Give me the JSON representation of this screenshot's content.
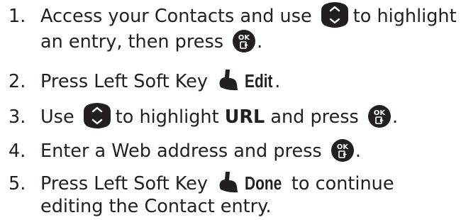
{
  "steps": [
    {
      "number": "1.",
      "line1_before": "Access your Contacts and use",
      "line1_after": "to highlight",
      "line2_before": "an entry, then press",
      "line2_after": ".",
      "icons": [
        "nav-key-icon",
        "ok-key-icon"
      ]
    },
    {
      "number": "2.",
      "before": "Press Left Soft Key",
      "key_label": "Edit",
      "after": ".",
      "icons": [
        "left-soft-key-icon"
      ]
    },
    {
      "number": "3.",
      "before": "Use",
      "middle": "to highlight",
      "bold": "URL",
      "after_bold": "and press",
      "end": ".",
      "icons": [
        "nav-key-icon",
        "ok-key-icon"
      ]
    },
    {
      "number": "4.",
      "before": "Enter a Web address and press",
      "end": ".",
      "icons": [
        "ok-key-icon"
      ]
    },
    {
      "number": "5.",
      "before": "Press Left Soft Key",
      "key_label": "Done",
      "after": "to continue",
      "line2": "editing the Contact entry.",
      "icons": [
        "left-soft-key-icon"
      ]
    }
  ],
  "colors": {
    "text": "#231f20",
    "icon": "#231f20"
  }
}
